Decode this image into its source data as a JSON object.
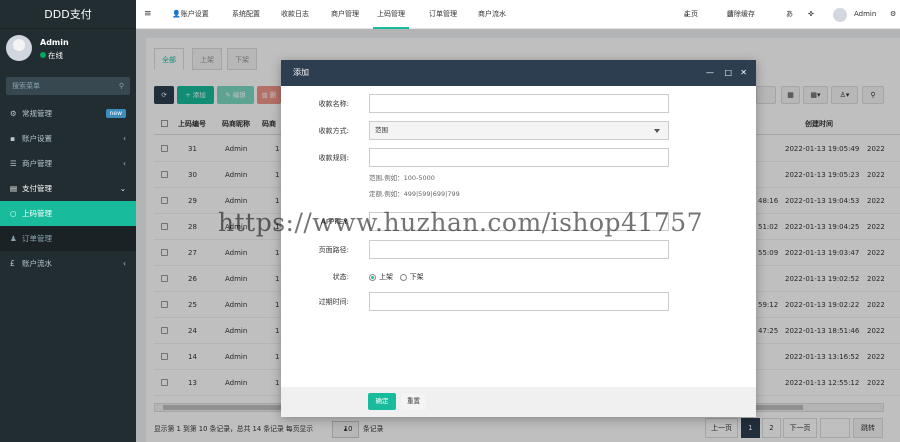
{
  "app": {
    "title": "DDD支付"
  },
  "user": {
    "name": "Admin",
    "status": "在线"
  },
  "sidebar": {
    "search_placeholder": "搜索菜单",
    "items": [
      {
        "label": "常规管理",
        "badge": "new"
      },
      {
        "label": "账户设置",
        "arrow": "‹"
      },
      {
        "label": "商户管理",
        "arrow": "‹"
      },
      {
        "label": "支付管理",
        "arrow": "⌄"
      },
      {
        "label": "上码管理"
      },
      {
        "label": "订单管理"
      },
      {
        "label": "账户流水",
        "arrow": "‹"
      }
    ]
  },
  "topbar": {
    "menu_icon": "≡",
    "tabs": [
      "账户设置",
      "系统配置",
      "收款日志",
      "商户管理",
      "上码管理",
      "订单管理",
      "商户流水"
    ],
    "home": "主页",
    "clear_cache": "清除缓存",
    "admin": "Admin"
  },
  "subtabs": [
    "全部",
    "上架",
    "下架"
  ],
  "toolbar": {
    "add": "添加",
    "edit": "编辑",
    "del": "删"
  },
  "table": {
    "headers": {
      "id": "上码编号",
      "nick": "码商昵称",
      "nick2": "码商",
      "created": "创建时间"
    },
    "rows": [
      {
        "id": "31",
        "nick": "Admin",
        "c3": "1",
        "t1": "",
        "created": "2022-01-13 19:05:49",
        "extra": "2022"
      },
      {
        "id": "30",
        "nick": "Admin",
        "c3": "1",
        "t1": "",
        "created": "2022-01-13 19:05:23",
        "extra": "2022"
      },
      {
        "id": "29",
        "nick": "Admin",
        "c3": "1",
        "t1": "48:16",
        "created": "2022-01-13 19:04:53",
        "extra": "2022"
      },
      {
        "id": "28",
        "nick": "Admin",
        "c3": "1",
        "t1": "51:02",
        "created": "2022-01-13 19:04:25",
        "extra": "2022"
      },
      {
        "id": "27",
        "nick": "Admin",
        "c3": "1",
        "t1": "55:09",
        "created": "2022-01-13 19:03:47",
        "extra": "2022"
      },
      {
        "id": "26",
        "nick": "Admin",
        "c3": "1",
        "t1": "",
        "created": "2022-01-13 19:02:52",
        "extra": "2022"
      },
      {
        "id": "25",
        "nick": "Admin",
        "c3": "1",
        "t1": "59:12",
        "created": "2022-01-13 19:02:22",
        "extra": "2022"
      },
      {
        "id": "24",
        "nick": "Admin",
        "c3": "1",
        "t1": "47:25",
        "created": "2022-01-13 18:51:46",
        "extra": "2022"
      },
      {
        "id": "14",
        "nick": "Admin",
        "c3": "1",
        "t1": "",
        "created": "2022-01-13 13:16:52",
        "extra": "2022"
      },
      {
        "id": "13",
        "nick": "Admin",
        "c3": "1",
        "t1": "",
        "created": "2022-01-13 12:55:12",
        "extra": "2022"
      }
    ]
  },
  "footer": {
    "summary": "显示第 1 到第 10 条记录，总共 14 条记录 每页显示",
    "per_page": "10",
    "suffix": "条记录"
  },
  "pagination": {
    "prev": "上一页",
    "p1": "1",
    "p2": "2",
    "next": "下一页",
    "jump": "跳转"
  },
  "modal": {
    "title": "添加",
    "fields": {
      "name": "收款名称:",
      "method": "收款方式:",
      "method_value": "范围",
      "rule": "收款规则:",
      "rule_hint1": "范围,例如：100-5000",
      "rule_hint2": "定额,例如：499|599|699|799",
      "key": "APPKEY:",
      "path": "页面路径:",
      "status": "状态:",
      "on": "上架",
      "off": "下架",
      "expire": "过期时间:"
    },
    "ok": "确定",
    "reset": "重置"
  },
  "watermark": "https://www.huzhan.com/ishop41757",
  "colors": {
    "accent": "#18bc9c",
    "sidebar": "#222d32",
    "modal_header": "#2c3e50"
  }
}
